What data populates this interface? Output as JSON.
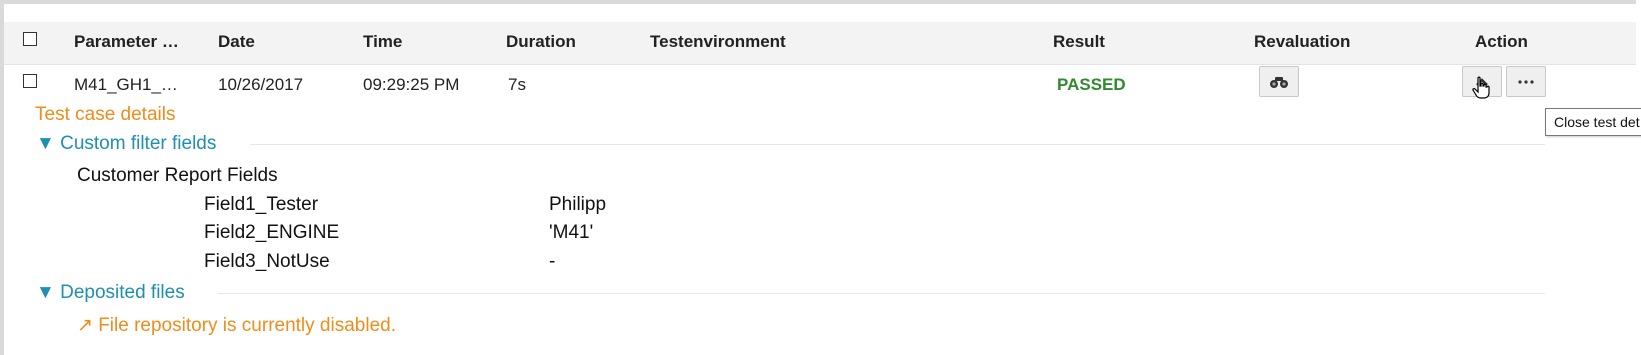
{
  "table": {
    "headers": {
      "parameter": "Parameter …",
      "date": "Date",
      "time": "Time",
      "duration": "Duration",
      "testenvironment": "Testenvironment",
      "result": "Result",
      "revaluation": "Revaluation",
      "action": "Action"
    },
    "row": {
      "parameter": "M41_GH1_…",
      "date": "10/26/2017",
      "time": "09:29:25 PM",
      "duration": "7s",
      "testenvironment": "",
      "result": "PASSED"
    }
  },
  "tooltip": "Close test det",
  "details": {
    "title": "Test case details",
    "custom_filter": {
      "heading": "Custom filter fields",
      "group_label": "Customer Report Fields",
      "fields": [
        {
          "name": "Field1_Tester",
          "value": "Philipp"
        },
        {
          "name": "Field2_ENGINE",
          "value": "'M41'"
        },
        {
          "name": "Field3_NotUse",
          "value": "-"
        }
      ]
    },
    "deposited_files": {
      "heading": "Deposited files",
      "message": "File repository is currently disabled."
    }
  },
  "icons": {
    "revaluation": "binoculars-icon",
    "close_details": "close-details-icon",
    "more": "more-icon",
    "expand": "triangle-down-icon",
    "link": "arrow-northeast-icon"
  },
  "colors": {
    "passed": "#2e8b2e",
    "orange": "#f08c1a",
    "teal": "#1f8fb0"
  }
}
